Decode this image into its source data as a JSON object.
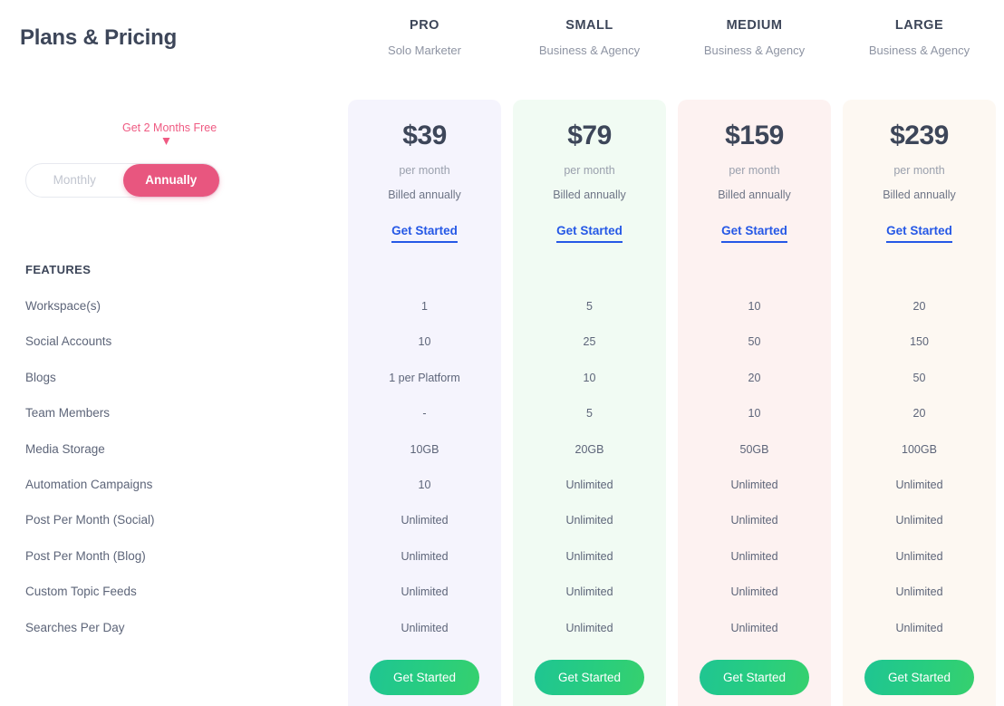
{
  "page": {
    "title": "Plans & Pricing",
    "features_heading": "FEATURES"
  },
  "billing": {
    "promo_note": "Get 2 Months Free",
    "monthly_label": "Monthly",
    "annually_label": "Annually",
    "selected": "Annually",
    "accent_color": "#e8567f"
  },
  "features": [
    "Workspace(s)",
    "Social Accounts",
    "Blogs",
    "Team Members",
    "Media Storage",
    "Automation Campaigns",
    "Post Per Month (Social)",
    "Post Per Month (Blog)",
    "Custom Topic Feeds",
    "Searches Per Day"
  ],
  "plans": [
    {
      "name": "PRO",
      "audience": "Solo Marketer",
      "price": "$39",
      "period": "per month",
      "billing_note": "Billed annually",
      "link_label": "Get Started",
      "cta_label": "Get Started",
      "card_color": "#f5f4fd",
      "values": [
        "1",
        "10",
        "1 per Platform",
        "-",
        "10GB",
        "10",
        "Unlimited",
        "Unlimited",
        "Unlimited",
        "Unlimited"
      ]
    },
    {
      "name": "SMALL",
      "audience": "Business & Agency",
      "price": "$79",
      "period": "per month",
      "billing_note": "Billed annually",
      "link_label": "Get Started",
      "cta_label": "Get Started",
      "card_color": "#f1fbf3",
      "values": [
        "5",
        "25",
        "10",
        "5",
        "20GB",
        "Unlimited",
        "Unlimited",
        "Unlimited",
        "Unlimited",
        "Unlimited"
      ]
    },
    {
      "name": "MEDIUM",
      "audience": "Business & Agency",
      "price": "$159",
      "period": "per month",
      "billing_note": "Billed annually",
      "link_label": "Get Started",
      "cta_label": "Get Started",
      "card_color": "#fdf2f1",
      "values": [
        "10",
        "50",
        "20",
        "10",
        "50GB",
        "Unlimited",
        "Unlimited",
        "Unlimited",
        "Unlimited",
        "Unlimited"
      ]
    },
    {
      "name": "LARGE",
      "audience": "Business & Agency",
      "price": "$239",
      "period": "per month",
      "billing_note": "Billed annually",
      "link_label": "Get Started",
      "cta_label": "Get Started",
      "card_color": "#fdf8f2",
      "values": [
        "20",
        "150",
        "50",
        "20",
        "100GB",
        "Unlimited",
        "Unlimited",
        "Unlimited",
        "Unlimited",
        "Unlimited"
      ]
    }
  ]
}
